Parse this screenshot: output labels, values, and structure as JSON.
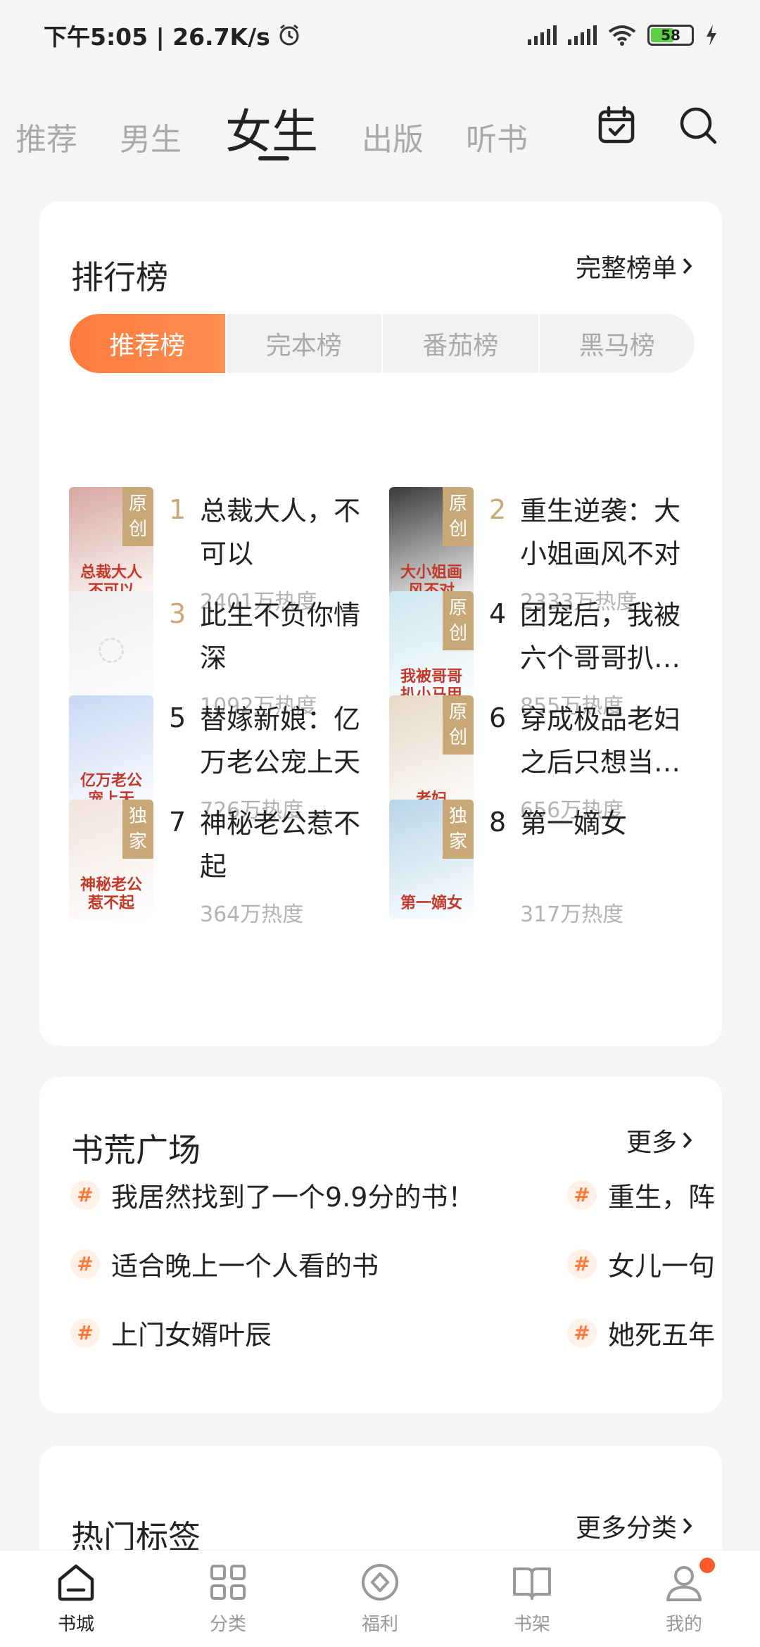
{
  "status": {
    "left": "下午5:05 | 26.7K/s",
    "battery": "58"
  },
  "top_tabs": [
    "推荐",
    "男生",
    "女生",
    "出版",
    "听书"
  ],
  "ranking": {
    "title": "排行榜",
    "more": "完整榜单",
    "segments": [
      "推荐榜",
      "完本榜",
      "番茄榜",
      "黑马榜"
    ],
    "items": [
      {
        "rank": "1",
        "title": "总裁大人，不可以",
        "heat": "2401万热度",
        "tag": "原创",
        "cover_text": "总裁大人不可以",
        "color": "#d8a8a0"
      },
      {
        "rank": "2",
        "title": "重生逆袭：大小姐画风不对",
        "heat": "2333万热度",
        "tag": "原创",
        "cover_text": "大小姐画风不对",
        "color": "#3a3a3a"
      },
      {
        "rank": "3",
        "title": "此生不负你情深",
        "heat": "1092万热度",
        "tag": "",
        "cover_text": "",
        "color": "#eeeeee"
      },
      {
        "rank": "4",
        "title": "团宠后，我被六个哥哥扒…",
        "heat": "855万热度",
        "tag": "原创",
        "cover_text": "我被哥哥扒小马甲",
        "color": "#cfe8f0"
      },
      {
        "rank": "5",
        "title": "替嫁新娘：亿万老公宠上天",
        "heat": "726万热度",
        "tag": "",
        "cover_text": "亿万老公宠上天",
        "color": "#c8d8f4"
      },
      {
        "rank": "6",
        "title": "穿成极品老妇之后只想当…",
        "heat": "656万热度",
        "tag": "原创",
        "cover_text": "老妇",
        "color": "#e6d9c8"
      },
      {
        "rank": "7",
        "title": "神秘老公惹不起",
        "heat": "364万热度",
        "tag": "独家",
        "cover_text": "神秘老公惹不起",
        "color": "#f2e4dc"
      },
      {
        "rank": "8",
        "title": "第一嫡女",
        "heat": "317万热度",
        "tag": "独家",
        "cover_text": "第一嫡女",
        "color": "#b8d6e8"
      }
    ]
  },
  "plaza": {
    "title": "书荒广场",
    "more": "更多",
    "topics_left": [
      "我居然找到了一个9.9分的书！",
      "适合晚上一个人看的书",
      "上门女婿叶辰"
    ],
    "topics_right": [
      "重生，阵",
      "女儿一句",
      "她死五年"
    ]
  },
  "hot_tags": {
    "title": "热门标签",
    "more": "更多分类"
  },
  "bottom_nav": [
    {
      "label": "书城",
      "icon": "home-icon"
    },
    {
      "label": "分类",
      "icon": "grid-icon"
    },
    {
      "label": "福利",
      "icon": "coin-icon"
    },
    {
      "label": "书架",
      "icon": "book-icon"
    },
    {
      "label": "我的",
      "icon": "person-icon"
    }
  ],
  "colors": {
    "accent": "#ff7a3d",
    "rank_top": "#c9a877",
    "cover_tag": "#c9a877"
  }
}
